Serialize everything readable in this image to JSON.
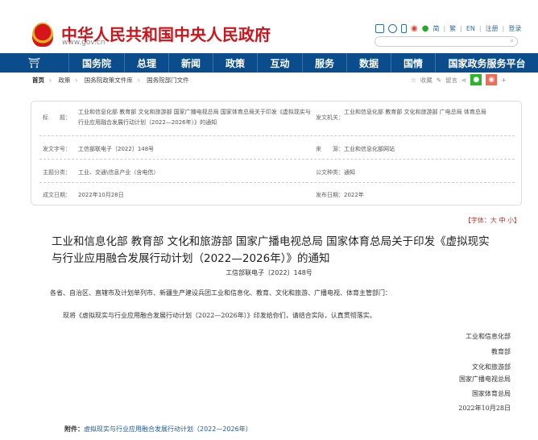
{
  "header": {
    "site_title": "中华人民共和国中央人民政府",
    "site_url": "www.gov.cn",
    "links": [
      "简",
      "繁",
      "EN",
      "注册",
      "登录"
    ],
    "search_placeholder": ""
  },
  "nav": [
    "国务院",
    "总理",
    "新闻",
    "政策",
    "互动",
    "服务",
    "数据",
    "国情",
    "国家政务服务平台"
  ],
  "breadcrumb": [
    "首页",
    "政策",
    "国务院政策文件库",
    "国务院部门文件"
  ],
  "share": {
    "favorite": "收藏",
    "comment": "留言"
  },
  "meta": {
    "title_label": "标　　题：",
    "title": "工业和信息化部 教育部 文化和旅游部 国家广播电视总局 国家体育总局关于印发《虚拟现实与行业应用融合发展行动计划（2022—2026年）》的通知",
    "issuer_label": "发文机关：",
    "issuer": "工业和信息化部 教育部 文化和旅游部 广电总局 体育总局",
    "docno_label": "发文字号：",
    "docno": "工信部联电子〔2022〕148号",
    "source_label": "来　　源：",
    "source": "工业和信息化部网站",
    "topic_label": "主题分类：",
    "topic": "工业、交通\\信息产业（含电信）",
    "type_label": "公文种类：",
    "type": "通知",
    "written_label": "成文日期：",
    "written": "2022年10月28日",
    "published_label": "发布日期：",
    "published": "2022年"
  },
  "font_size": {
    "label": "【字体：",
    "large": "大",
    "medium": "中",
    "small": "小",
    "end": "】"
  },
  "doc": {
    "title": "工业和信息化部 教育部 文化和旅游部 国家广播电视总局 国家体育总局关于印发《虚拟现实与行业应用融合发展行动计划（2022—2026年）》的通知",
    "number": "工信部联电子〔2022〕148号",
    "salutation": "各省、自治区、直辖市及计划单列市、新疆生产建设兵团工业和信息化、教育、文化和旅游、广播电视、体育主管部门：",
    "body": "现将《虚拟现实与行业应用融合发展行动计划（2022—2026年）》印发给你们，请结合实际，认真贯彻落实。",
    "signatures": [
      "工业和信息化部",
      "教育部",
      "文化和旅游部",
      "国家广播电视总局",
      "国家体育总局",
      "2022年10月28日"
    ],
    "attachment_label": "附件：",
    "attachment": "虚拟现实与行业应用融合发展行动计划（2022—2026年）"
  }
}
